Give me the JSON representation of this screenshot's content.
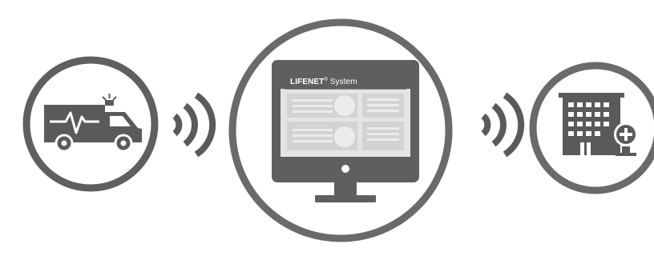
{
  "diagram": {
    "screen": {
      "brand": "LIFENET",
      "trademark": "®",
      "product": " System"
    },
    "nodes": [
      {
        "id": "ambulance",
        "icon": "ambulance-icon"
      },
      {
        "id": "monitor",
        "icon": "monitor-icon"
      },
      {
        "id": "hospital",
        "icon": "hospital-icon"
      }
    ],
    "links": [
      {
        "from": "ambulance",
        "to": "monitor",
        "icon": "wireless-signal-icon"
      },
      {
        "from": "monitor",
        "to": "hospital",
        "icon": "wireless-signal-icon"
      }
    ],
    "colors": {
      "dark_gray": "#5a5a5a",
      "mid_gray": "#6e6e6e",
      "light_gray": "#dcdcdc",
      "panel_gray": "#e8e8e8",
      "background": "#ffffff"
    }
  }
}
